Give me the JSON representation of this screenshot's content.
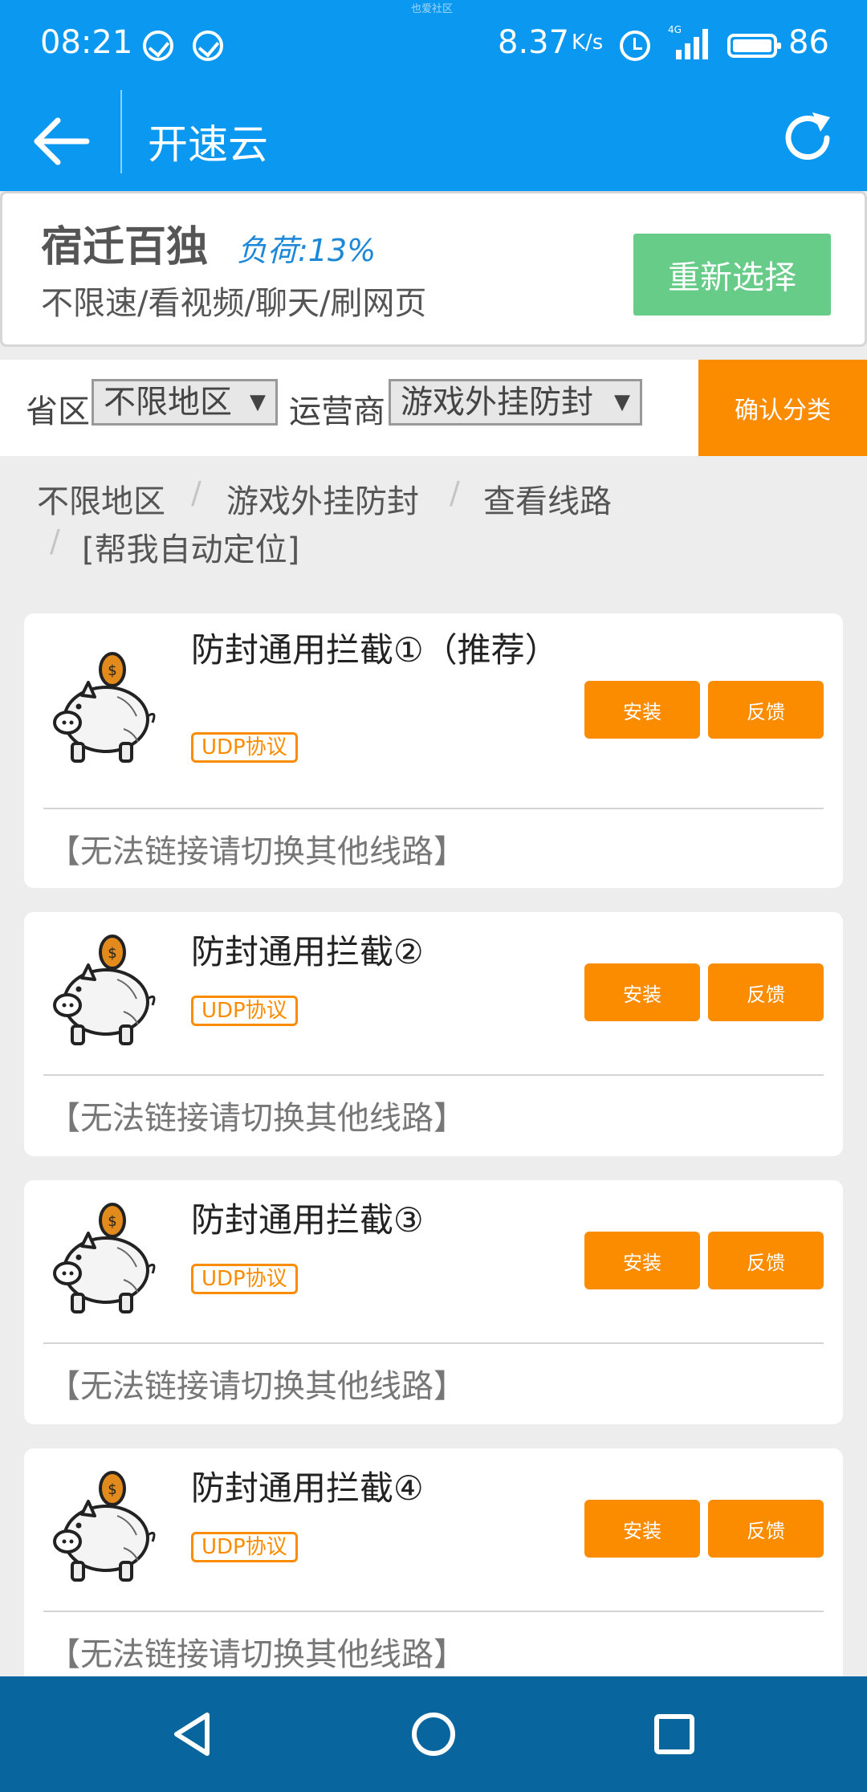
{
  "status_bar": {
    "time": "08:21",
    "speed": "8.37",
    "speed_unit": "K/s",
    "network": "4G",
    "battery": "86",
    "notch_text": "也爱社区"
  },
  "app_bar": {
    "title": "开速云"
  },
  "server": {
    "name": "宿迁百独",
    "load": "负荷:13%",
    "description": "不限速/看视频/聊天/刷网页",
    "reselect_label": "重新选择"
  },
  "filter": {
    "province_label": "省区",
    "province_value": "不限地区",
    "carrier_label": "运营商",
    "carrier_value": "游戏外挂防封",
    "confirm_label": "确认分类"
  },
  "breadcrumb": [
    "不限地区",
    "游戏外挂防封",
    "查看线路",
    "[帮我自动定位]"
  ],
  "routes": [
    {
      "title": "防封通用拦截①（推荐）",
      "badge": "UDP协议",
      "install": "安装",
      "feedback": "反馈",
      "note": "【无法链接请切换其他线路】"
    },
    {
      "title": "防封通用拦截②",
      "badge": "UDP协议",
      "install": "安装",
      "feedback": "反馈",
      "note": "【无法链接请切换其他线路】"
    },
    {
      "title": "防封通用拦截③",
      "badge": "UDP协议",
      "install": "安装",
      "feedback": "反馈",
      "note": "【无法链接请切换其他线路】"
    },
    {
      "title": "防封通用拦截④",
      "badge": "UDP协议",
      "install": "安装",
      "feedback": "反馈",
      "note": "【无法链接请切换其他线路】"
    }
  ],
  "colors": {
    "header_blue": "#0b98f0",
    "nav_blue": "#08659e",
    "accent_orange": "#fb8c00",
    "reselect_green": "#66cc88",
    "load_blue": "#1e88d8"
  },
  "icons": {
    "back": "arrow-left-icon",
    "refresh": "refresh-icon",
    "route": "piggy-bank-icon",
    "nav_back": "triangle-back-icon",
    "nav_home": "circle-home-icon",
    "nav_recents": "square-recents-icon"
  }
}
